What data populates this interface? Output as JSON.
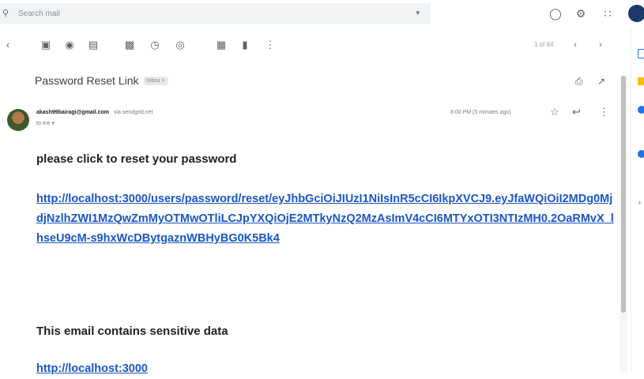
{
  "search": {
    "placeholder": "Search mail"
  },
  "header_icons": [
    "support-icon",
    "settings-icon",
    "apps-grid-icon"
  ],
  "toolbar": {
    "buttons": [
      "back-icon",
      "archive-icon",
      "report-spam-icon",
      "delete-icon",
      "mark-unread-icon",
      "snooze-icon",
      "add-task-icon",
      "move-to-icon",
      "labels-icon",
      "more-icon"
    ],
    "pager": "1 of 84"
  },
  "email": {
    "subject": "Password Reset Link",
    "label_chip": "Inbox ×",
    "sender_email": "akash99bairagi@gmail.com",
    "via": "via sendgrid.net",
    "to": "to me ▾",
    "time": "8:00 PM (5 minutes ago)",
    "body_line1": "please click to reset your password",
    "reset_link": "http://localhost:3000/users/password/reset/eyJhbGciOiJIUzI1NiIsInR5cCI6IkpXVCJ9.eyJfaWQiOiI2MDg0MjdjNzlhZWI1MzQwZmMyOTMwOTliLCJpYXQiOjE2MTkyNzQ2MzAsImV4cCI6MTYxOTI3NTIzMH0.2OaRMvX_lhseU9cM-s9hxWcDBytgaznWBHyBG0K5Bk4",
    "body_line2": "This email contains sensitive data",
    "second_link": "http://localhost:3000"
  },
  "colors": {
    "link": "#1a56c4",
    "search_bg": "#f1f3f4"
  }
}
